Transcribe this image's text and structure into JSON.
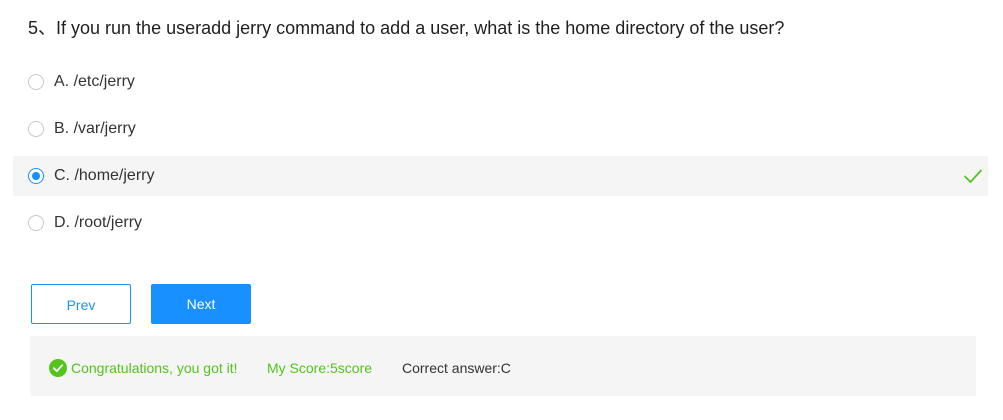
{
  "question": {
    "text": "5、If you run the useradd jerry command to add a user, what is the home directory of the user?"
  },
  "options": [
    {
      "label": "A. /etc/jerry"
    },
    {
      "label": "B. /var/jerry"
    },
    {
      "label": "C. /home/jerry"
    },
    {
      "label": "D. /root/jerry"
    }
  ],
  "buttons": {
    "prev": "Prev",
    "next": "Next"
  },
  "result": {
    "message": "Congratulations, you got it!",
    "score": "My Score:5score",
    "correct_answer": "Correct answer:C"
  },
  "icons": {
    "check": "check-icon",
    "success": "check-circle-icon"
  },
  "colors": {
    "accent": "#1890ff",
    "success": "#52c41a",
    "text": "#333333",
    "panel": "#f5f5f5"
  }
}
